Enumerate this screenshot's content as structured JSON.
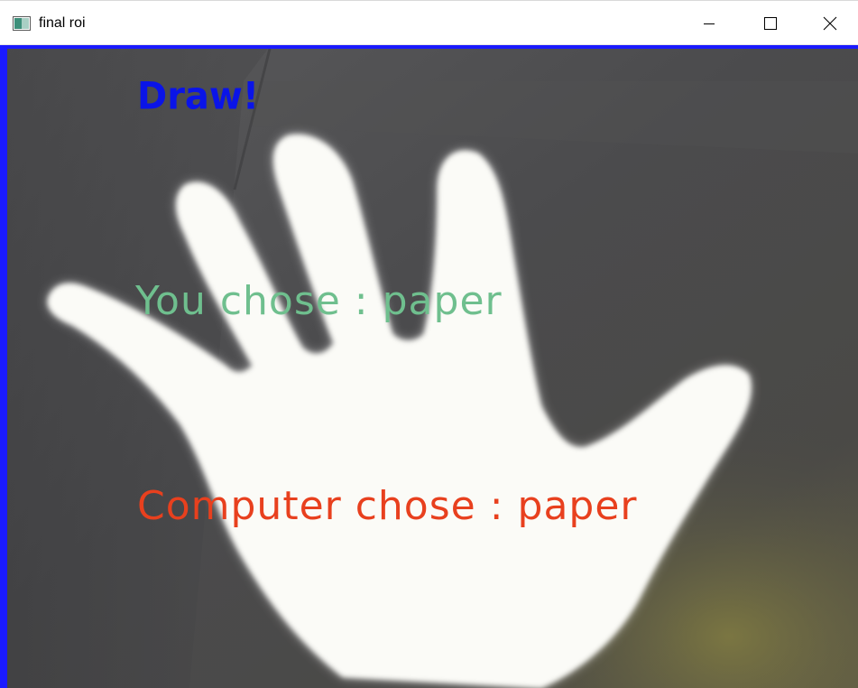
{
  "window": {
    "title": "final roi",
    "controls": {
      "minimize_icon": "minimize-icon",
      "maximize_icon": "maximize-icon",
      "close_icon": "close-icon"
    }
  },
  "overlay": {
    "result_text": "Draw!",
    "user_choice_text": "You chose : paper",
    "computer_choice_text": "Computer chose : paper"
  },
  "colors": {
    "result": "#0a14e8",
    "user_choice": "#6fbf8e",
    "computer_choice": "#e8401e",
    "frame_border": "#1a1aff"
  }
}
